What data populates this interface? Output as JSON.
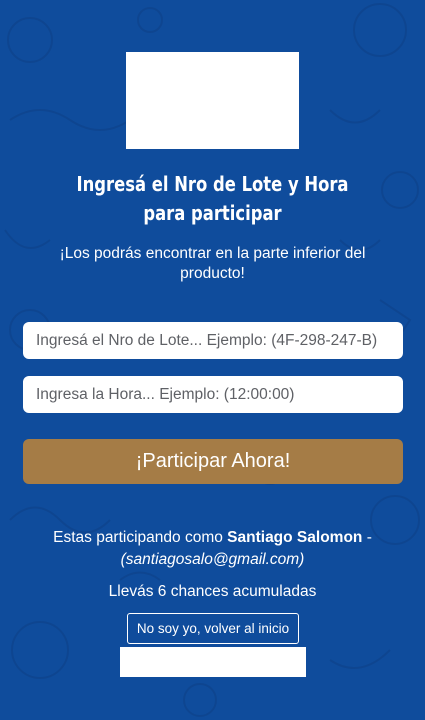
{
  "heading": "Ingresá el Nro de Lote y Hora para participar",
  "subheading": "¡Los podrás encontrar en la parte inferior del producto!",
  "form": {
    "lote_placeholder": "Ingresá el Nro de Lote... Ejemplo: (4F-298-247-B)",
    "hora_placeholder": "Ingresa la Hora... Ejemplo: (12:00:00)",
    "submit_label": "¡Participar Ahora!"
  },
  "user": {
    "prefix": "Estas participando como ",
    "name": "Santiago Salomon",
    "separator": " -",
    "email": "(santiagosalo@gmail.com)"
  },
  "chances": "Llevás 6 chances acumuladas",
  "back_label": "No soy yo, volver al inicio",
  "colors": {
    "background": "#0f4c9c",
    "button": "#a57c46",
    "text": "#ffffff"
  }
}
